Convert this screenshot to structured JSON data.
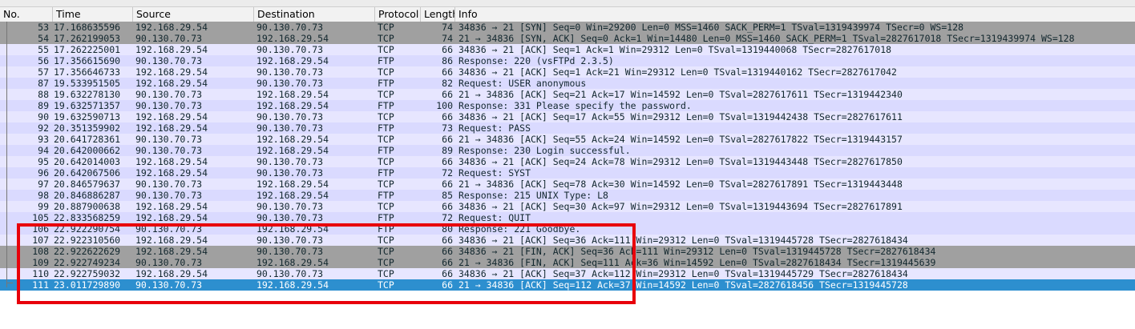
{
  "columns": [
    "No.",
    "Time",
    "Source",
    "Destination",
    "Protocol",
    "Length",
    "Info"
  ],
  "colors": {
    "tcp_syn_fin_bg": "#a0a0a0",
    "tcp_bg": "#e7e6ff",
    "ftp_bg": "#dadaff",
    "selected_bg": "#2d8fcf",
    "highlight_box": "#e8000b"
  },
  "packets": [
    {
      "no": "53",
      "time": "17.168635596",
      "source": "192.168.29.54",
      "destination": "90.130.70.73",
      "protocol": "TCP",
      "length": "74",
      "info": "34836 → 21 [SYN] Seq=0 Win=29200 Len=0 MSS=1460 SACK_PERM=1 TSval=1319439974 TSecr=0 WS=128",
      "style": "gray"
    },
    {
      "no": "54",
      "time": "17.262199053",
      "source": "90.130.70.73",
      "destination": "192.168.29.54",
      "protocol": "TCP",
      "length": "74",
      "info": "21 → 34836 [SYN, ACK] Seq=0 Ack=1 Win=14480 Len=0 MSS=1460 SACK_PERM=1 TSval=2827617018 TSecr=1319439974 WS=128",
      "style": "gray"
    },
    {
      "no": "55",
      "time": "17.262225001",
      "source": "192.168.29.54",
      "destination": "90.130.70.73",
      "protocol": "TCP",
      "length": "66",
      "info": "34836 → 21 [ACK] Seq=1 Ack=1 Win=29312 Len=0 TSval=1319440068 TSecr=2827617018",
      "style": "tcp"
    },
    {
      "no": "56",
      "time": "17.356615690",
      "source": "90.130.70.73",
      "destination": "192.168.29.54",
      "protocol": "FTP",
      "length": "86",
      "info": "Response: 220 (vsFTPd 2.3.5)",
      "style": "ftp"
    },
    {
      "no": "57",
      "time": "17.356646733",
      "source": "192.168.29.54",
      "destination": "90.130.70.73",
      "protocol": "TCP",
      "length": "66",
      "info": "34836 → 21 [ACK] Seq=1 Ack=21 Win=29312 Len=0 TSval=1319440162 TSecr=2827617042",
      "style": "tcp"
    },
    {
      "no": "87",
      "time": "19.533951505",
      "source": "192.168.29.54",
      "destination": "90.130.70.73",
      "protocol": "FTP",
      "length": "82",
      "info": "Request: USER anonymous",
      "style": "ftp"
    },
    {
      "no": "88",
      "time": "19.632278130",
      "source": "90.130.70.73",
      "destination": "192.168.29.54",
      "protocol": "TCP",
      "length": "66",
      "info": "21 → 34836 [ACK] Seq=21 Ack=17 Win=14592 Len=0 TSval=2827617611 TSecr=1319442340",
      "style": "tcp"
    },
    {
      "no": "89",
      "time": "19.632571357",
      "source": "90.130.70.73",
      "destination": "192.168.29.54",
      "protocol": "FTP",
      "length": "100",
      "info": "Response: 331 Please specify the password.",
      "style": "ftp"
    },
    {
      "no": "90",
      "time": "19.632590713",
      "source": "192.168.29.54",
      "destination": "90.130.70.73",
      "protocol": "TCP",
      "length": "66",
      "info": "34836 → 21 [ACK] Seq=17 Ack=55 Win=29312 Len=0 TSval=1319442438 TSecr=2827617611",
      "style": "tcp"
    },
    {
      "no": "92",
      "time": "20.351359902",
      "source": "192.168.29.54",
      "destination": "90.130.70.73",
      "protocol": "FTP",
      "length": "73",
      "info": "Request: PASS",
      "style": "ftp"
    },
    {
      "no": "93",
      "time": "20.641728361",
      "source": "90.130.70.73",
      "destination": "192.168.29.54",
      "protocol": "TCP",
      "length": "66",
      "info": "21 → 34836 [ACK] Seq=55 Ack=24 Win=14592 Len=0 TSval=2827617822 TSecr=1319443157",
      "style": "tcp"
    },
    {
      "no": "94",
      "time": "20.642000662",
      "source": "90.130.70.73",
      "destination": "192.168.29.54",
      "protocol": "FTP",
      "length": "89",
      "info": "Response: 230 Login successful.",
      "style": "ftp"
    },
    {
      "no": "95",
      "time": "20.642014003",
      "source": "192.168.29.54",
      "destination": "90.130.70.73",
      "protocol": "TCP",
      "length": "66",
      "info": "34836 → 21 [ACK] Seq=24 Ack=78 Win=29312 Len=0 TSval=1319443448 TSecr=2827617850",
      "style": "tcp"
    },
    {
      "no": "96",
      "time": "20.642067506",
      "source": "192.168.29.54",
      "destination": "90.130.70.73",
      "protocol": "FTP",
      "length": "72",
      "info": "Request: SYST",
      "style": "ftp"
    },
    {
      "no": "97",
      "time": "20.846579637",
      "source": "90.130.70.73",
      "destination": "192.168.29.54",
      "protocol": "TCP",
      "length": "66",
      "info": "21 → 34836 [ACK] Seq=78 Ack=30 Win=14592 Len=0 TSval=2827617891 TSecr=1319443448",
      "style": "tcp"
    },
    {
      "no": "98",
      "time": "20.846886287",
      "source": "90.130.70.73",
      "destination": "192.168.29.54",
      "protocol": "FTP",
      "length": "85",
      "info": "Response: 215 UNIX Type: L8",
      "style": "ftp"
    },
    {
      "no": "99",
      "time": "20.887900638",
      "source": "192.168.29.54",
      "destination": "90.130.70.73",
      "protocol": "TCP",
      "length": "66",
      "info": "34836 → 21 [ACK] Seq=30 Ack=97 Win=29312 Len=0 TSval=1319443694 TSecr=2827617891",
      "style": "tcp"
    },
    {
      "no": "105",
      "time": "22.833568259",
      "source": "192.168.29.54",
      "destination": "90.130.70.73",
      "protocol": "FTP",
      "length": "72",
      "info": "Request: QUIT",
      "style": "ftp"
    },
    {
      "no": "106",
      "time": "22.922290754",
      "source": "90.130.70.73",
      "destination": "192.168.29.54",
      "protocol": "FTP",
      "length": "80",
      "info": "Response: 221 Goodbye.",
      "style": "ftp"
    },
    {
      "no": "107",
      "time": "22.922310560",
      "source": "192.168.29.54",
      "destination": "90.130.70.73",
      "protocol": "TCP",
      "length": "66",
      "info": "34836 → 21 [ACK] Seq=36 Ack=111 Win=29312 Len=0 TSval=1319445728 TSecr=2827618434",
      "style": "tcp"
    },
    {
      "no": "108",
      "time": "22.922622629",
      "source": "192.168.29.54",
      "destination": "90.130.70.73",
      "protocol": "TCP",
      "length": "66",
      "info": "34836 → 21 [FIN, ACK] Seq=36 Ack=111 Win=29312 Len=0 TSval=1319445728 TSecr=2827618434",
      "style": "gray"
    },
    {
      "no": "109",
      "time": "22.922749234",
      "source": "90.130.70.73",
      "destination": "192.168.29.54",
      "protocol": "TCP",
      "length": "66",
      "info": "21 → 34836 [FIN, ACK] Seq=111 Ack=36 Win=14592 Len=0 TSval=2827618434 TSecr=1319445639",
      "style": "gray"
    },
    {
      "no": "110",
      "time": "22.922759032",
      "source": "192.168.29.54",
      "destination": "90.130.70.73",
      "protocol": "TCP",
      "length": "66",
      "info": "34836 → 21 [ACK] Seq=37 Ack=112 Win=29312 Len=0 TSval=1319445729 TSecr=2827618434",
      "style": "tcp"
    },
    {
      "no": "111",
      "time": "23.011729890",
      "source": "90.130.70.73",
      "destination": "192.168.29.54",
      "protocol": "TCP",
      "length": "66",
      "info": "21 → 34836 [ACK] Seq=112 Ack=37 Win=14592 Len=0 TSval=2827618456 TSecr=1319445728",
      "style": "selected"
    }
  ]
}
